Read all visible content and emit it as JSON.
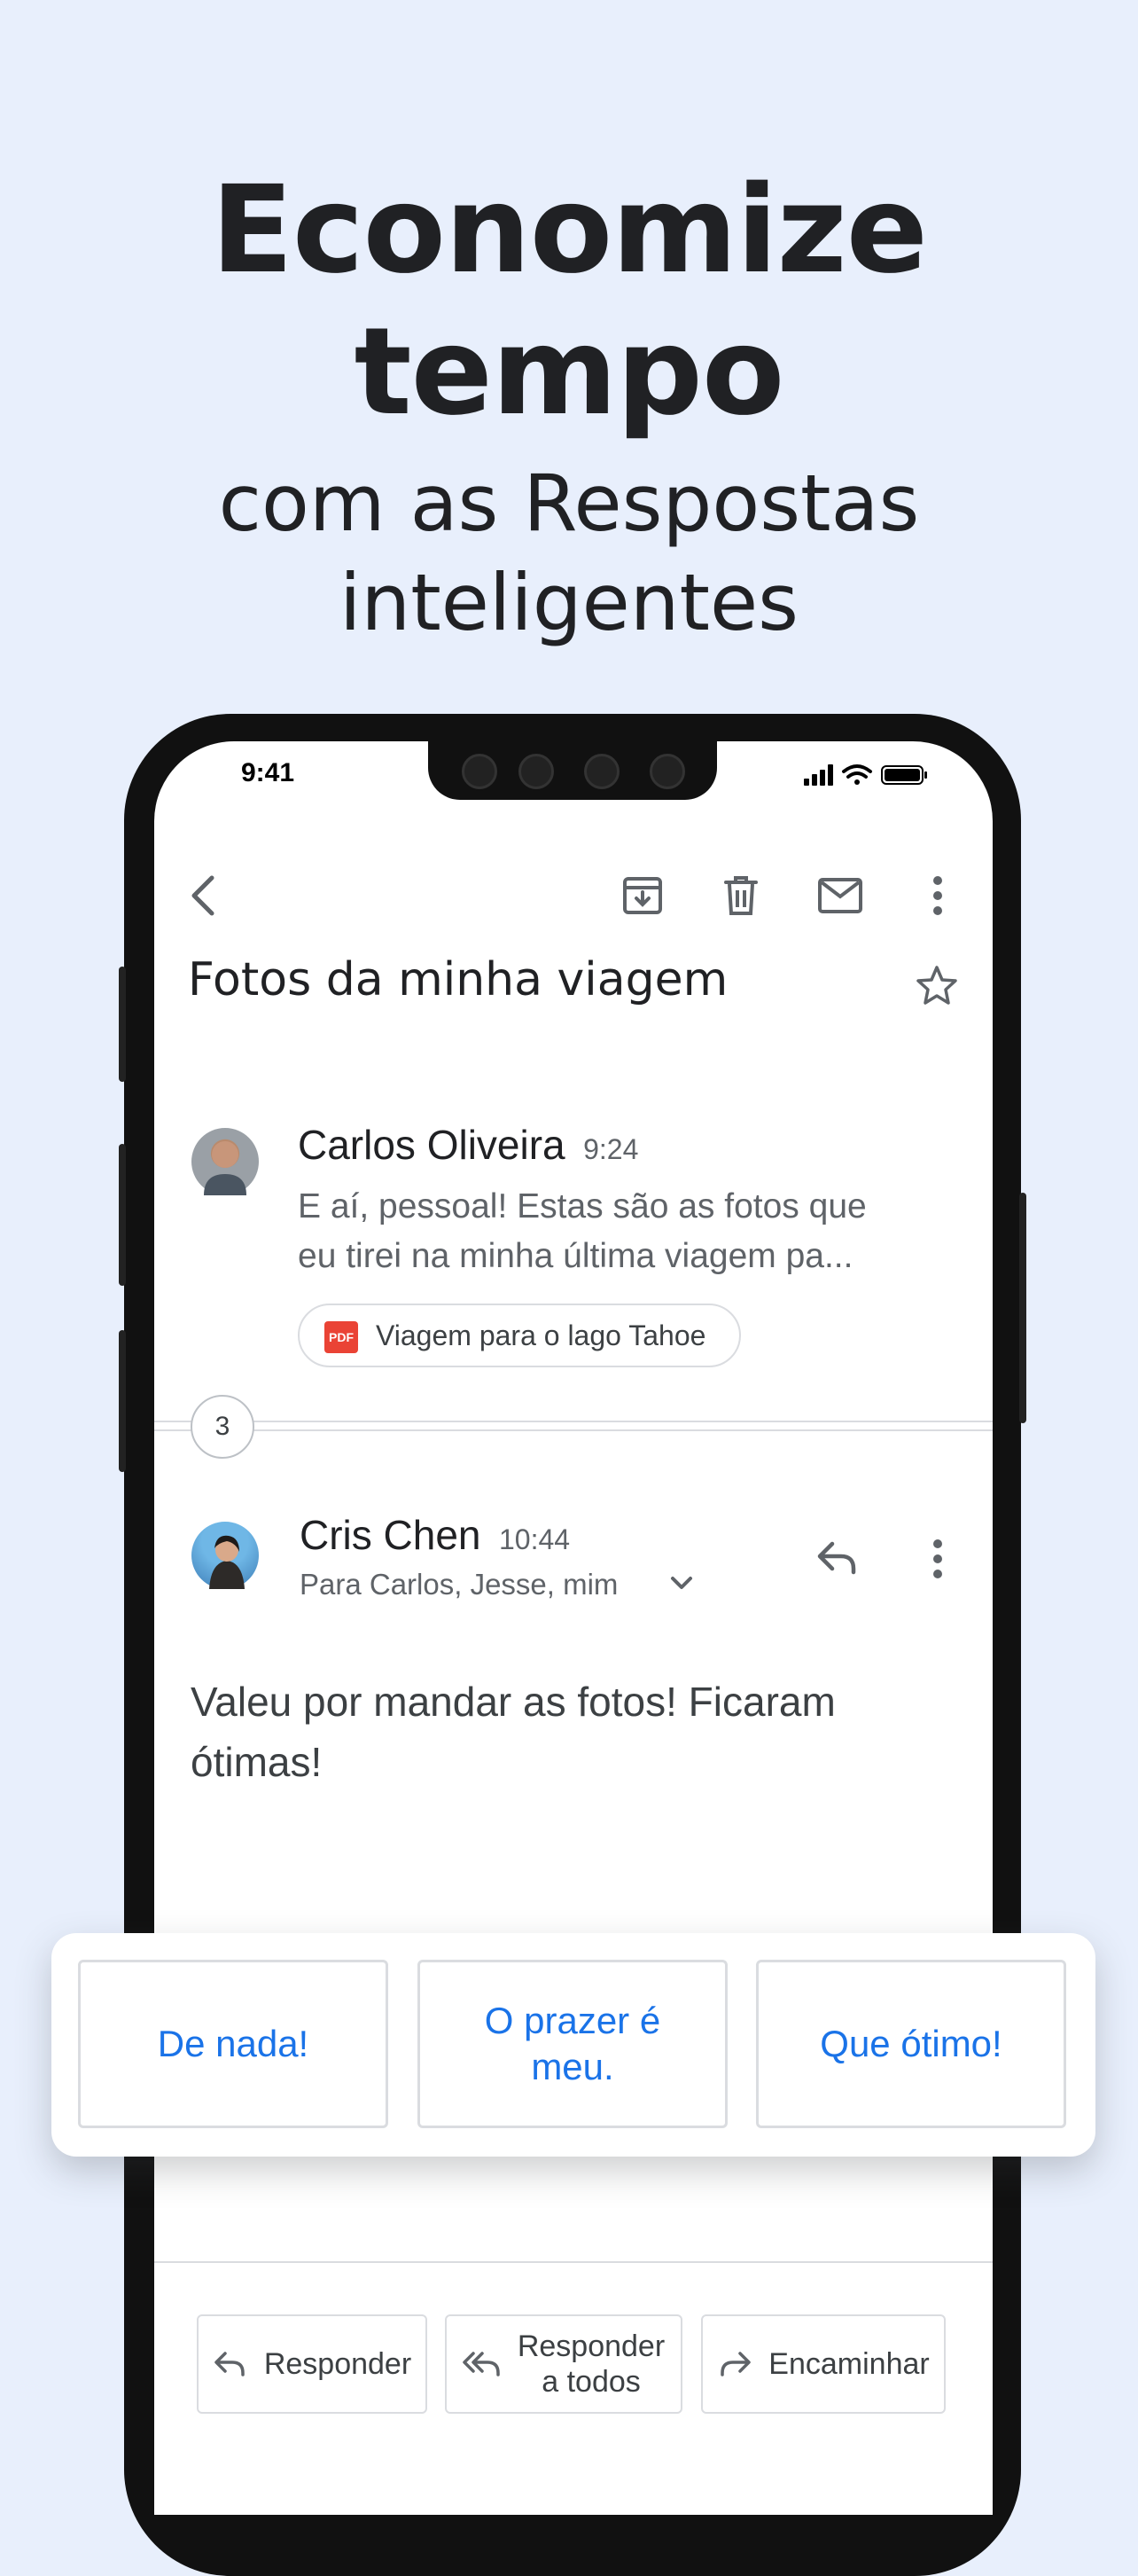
{
  "promo": {
    "headline_line1": "Economize",
    "headline_line2": "tempo",
    "subline_line1": "com as Respostas",
    "subline_line2": "inteligentes"
  },
  "status_bar": {
    "time": "9:41"
  },
  "toolbar": {
    "icons": [
      "back-icon",
      "archive-icon",
      "delete-icon",
      "mark-unread-icon",
      "more-icon"
    ]
  },
  "email": {
    "subject": "Fotos da minha viagem",
    "first_message": {
      "sender": "Carlos Oliveira",
      "time": "9:24",
      "snippet_line1": "E aí, pessoal! Estas são as fotos que",
      "snippet_line2": "eu tirei na minha última viagem pa...",
      "attachment": {
        "badge": "PDF",
        "name": "Viagem para o lago Tahoe"
      }
    },
    "collapsed_count": "3",
    "second_message": {
      "sender": "Cris Chen",
      "time": "10:44",
      "recipients": "Para Carlos, Jesse, mim",
      "body_line1": "Valeu por mandar as fotos! Ficaram",
      "body_line2": "ótimas!"
    }
  },
  "smart_replies": [
    "De nada!",
    "O prazer é meu.",
    "Que ótimo!"
  ],
  "actions": {
    "reply": "Responder",
    "reply_all_line1": "Responder",
    "reply_all_line2": "a todos",
    "forward": "Encaminhar"
  },
  "colors": {
    "background": "#e8effc",
    "accent": "#1a73e8",
    "pdf": "#ea4335"
  }
}
